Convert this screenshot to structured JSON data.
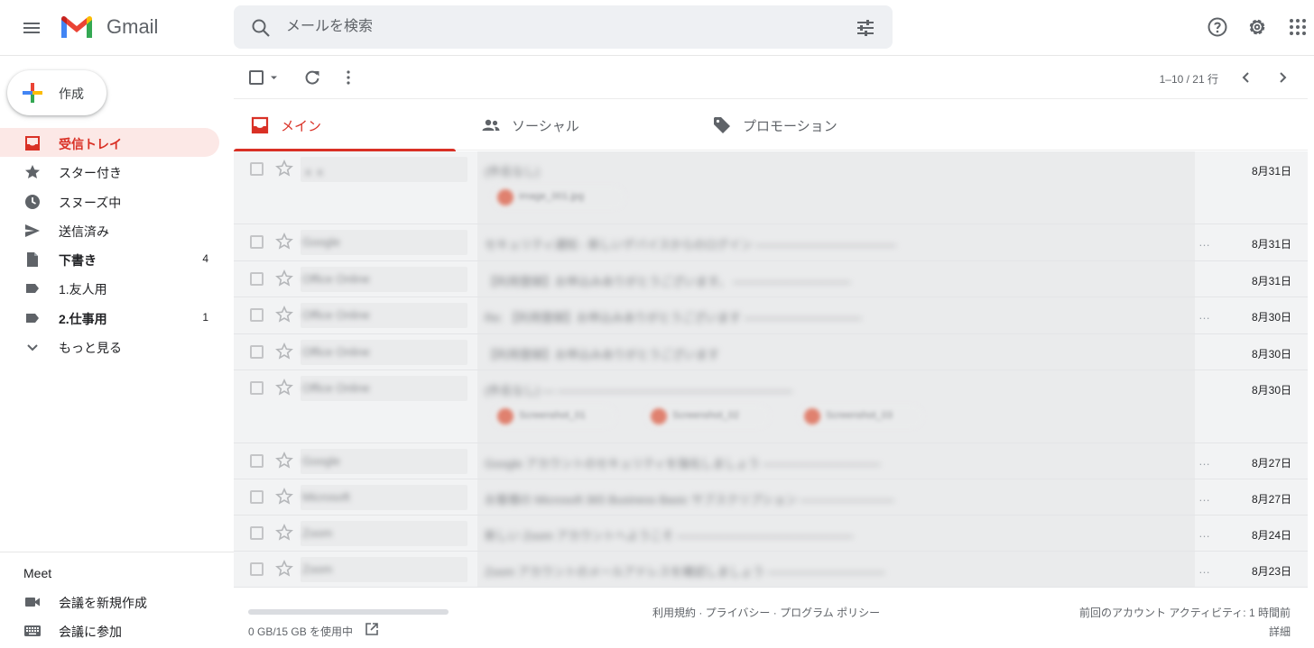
{
  "header": {
    "brand": "Gmail",
    "search_placeholder": "メールを検索"
  },
  "compose": {
    "label": "作成"
  },
  "sidebar": {
    "items": [
      {
        "label": "受信トレイ",
        "count": "",
        "icon": "inbox-icon",
        "active": true
      },
      {
        "label": "スター付き",
        "count": "",
        "icon": "star-icon"
      },
      {
        "label": "スヌーズ中",
        "count": "",
        "icon": "clock-icon"
      },
      {
        "label": "送信済み",
        "count": "",
        "icon": "send-icon"
      },
      {
        "label": "下書き",
        "count": "4",
        "icon": "draft-icon"
      },
      {
        "label": "1.友人用",
        "count": "",
        "icon": "label-icon"
      },
      {
        "label": "2.仕事用",
        "count": "1",
        "icon": "label-icon"
      },
      {
        "label": "もっと見る",
        "count": "",
        "icon": "chevron-down-icon"
      }
    ]
  },
  "meet": {
    "title": "Meet",
    "new_meeting": "会議を新規作成",
    "join_meeting": "会議に参加"
  },
  "toolbar": {
    "pager": "1–10 / 21 行"
  },
  "tabs": [
    {
      "label": "メイン",
      "icon": "inbox-icon"
    },
    {
      "label": "ソーシャル",
      "icon": "people-icon"
    },
    {
      "label": "プロモーション",
      "icon": "tag-icon"
    }
  ],
  "emails": [
    {
      "sender": "ｘｘ",
      "snippet": "(件名なし)",
      "date": "8月31日",
      "attachments": [
        "image_001.jpg"
      ]
    },
    {
      "sender": "Google",
      "snippet": "セキュリティ通知 - 新しいデバイスからのログイン ――――――――――――",
      "date": "8月31日"
    },
    {
      "sender": "Office Online",
      "snippet": "【利用登録】お申込みありがとうございます。 ――――――――――",
      "date": "8月31日"
    },
    {
      "sender": "Office Online",
      "snippet": "Re: 【利用登録】お申込みありがとうございます ――――――――――",
      "date": "8月30日"
    },
    {
      "sender": "Office Online",
      "snippet": "【利用登録】お申込みありがとうございます",
      "date": "8月30日"
    },
    {
      "sender": "Office Online",
      "snippet": "(件名なし) ― ――――――――――――――――――――",
      "date": "8月30日",
      "attachments": [
        "Screenshot_01",
        "Screenshot_02",
        "Screenshot_03"
      ]
    },
    {
      "sender": "Google",
      "snippet": "Google アカウントのセキュリティを強化しましょう ――――――――――",
      "date": "8月27日"
    },
    {
      "sender": "Microsoft",
      "snippet": "お客様の Microsoft 365 Business Basic サブスクリプション ――――――――",
      "date": "8月27日"
    },
    {
      "sender": "Zoom",
      "snippet": "新しい Zoom アカウントへようこそ ―――――――――――――――",
      "date": "8月24日"
    },
    {
      "sender": "Zoom",
      "snippet": "Zoom アカウントのメールアドレスを確認しましょう ――――――――――",
      "date": "8月23日"
    }
  ],
  "footer": {
    "storage": "0 GB/15 GB を使用中",
    "links": "利用規約 · プライバシー · プログラム ポリシー",
    "activity": "前回のアカウント アクティビティ: 1 時間前",
    "details": "詳細"
  }
}
